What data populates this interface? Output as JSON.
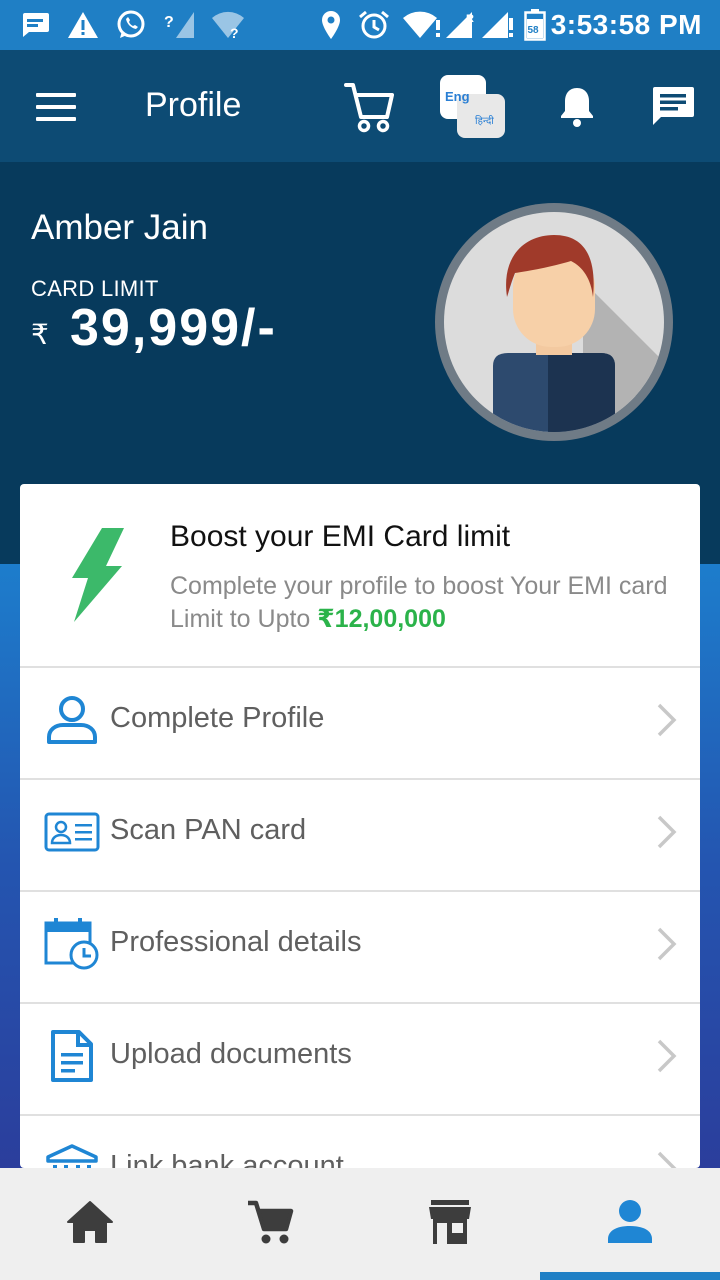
{
  "status_bar": {
    "time": "3:53:58 PM",
    "icons": [
      "message-icon",
      "warning-icon",
      "whatsapp-icon",
      "signal-unknown-icon",
      "wifi-unknown-icon",
      "location-icon",
      "alarm-icon",
      "wifi-icon",
      "signal-roaming-icon",
      "signal-icon",
      "battery-icon"
    ],
    "battery_level": "58"
  },
  "app_bar": {
    "title": "Profile",
    "language_primary": "Eng",
    "language_secondary": "हिन्दी",
    "icons": [
      "menu-icon",
      "cart-icon",
      "language-toggle-icon",
      "bell-icon",
      "chat-icon"
    ]
  },
  "profile": {
    "name": "Amber Jain",
    "card_limit_label": "CARD LIMIT",
    "currency_symbol": "₹",
    "card_limit_amount": "39,999/-"
  },
  "boost": {
    "title": "Boost your EMI Card limit",
    "description": "Complete your profile to boost Your EMI card Limit to Upto ",
    "amount": "₹12,00,000",
    "icon": "lightning-icon"
  },
  "menu": [
    {
      "label": "Complete Profile",
      "icon": "person-icon"
    },
    {
      "label": "Scan PAN card",
      "icon": "id-card-icon"
    },
    {
      "label": "Professional details",
      "icon": "calendar-clock-icon"
    },
    {
      "label": "Upload documents",
      "icon": "document-icon"
    },
    {
      "label": "Link bank account",
      "icon": "bank-icon"
    }
  ],
  "bottom_nav": {
    "items": [
      "home-icon",
      "cart-icon",
      "store-icon",
      "profile-icon"
    ],
    "active": "profile-icon"
  },
  "colors": {
    "status_bar": "#1f7fc5",
    "app_bar": "#0d4b74",
    "header": "#073a5c",
    "accent_blue": "#1f86d4",
    "boost_green": "#2bb34a",
    "bolt_green": "#3cb96a"
  }
}
